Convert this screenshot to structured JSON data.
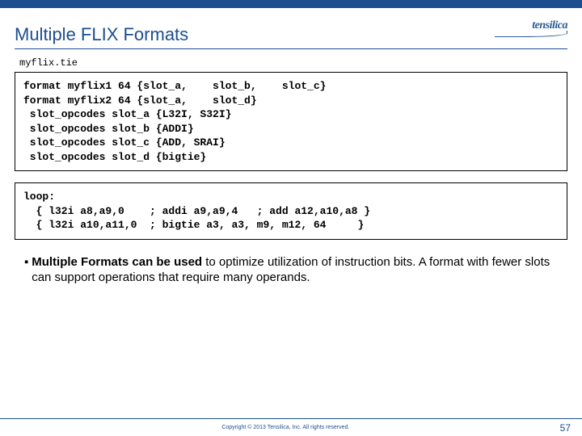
{
  "header": {
    "title": "Multiple FLIX Formats",
    "logo_text": "tensilica"
  },
  "filename": "myflix.tie",
  "code_box_1": "format myflix1 64 {slot_a,    slot_b,    slot_c}\nformat myflix2 64 {slot_a,    slot_d}\n slot_opcodes slot_a {L32I, S32I}\n slot_opcodes slot_b {ADDI}\n slot_opcodes slot_c {ADD, SRAI}\n slot_opcodes slot_d {bigtie}",
  "code_box_2": "loop:\n  { l32i a8,a9,0    ; addi a9,a9,4   ; add a12,a10,a8 }\n  { l32i a10,a11,0  ; bigtie a3, a3, m9, m12, 64     }",
  "body": {
    "bold": "Multiple Formats can be used",
    "rest": " to optimize utilization of instruction bits.  A format with fewer slots can support operations that require many operands."
  },
  "footer": {
    "copyright": "Copyright © 2013  Tensilica, Inc. All rights reserved.",
    "page": "57"
  }
}
